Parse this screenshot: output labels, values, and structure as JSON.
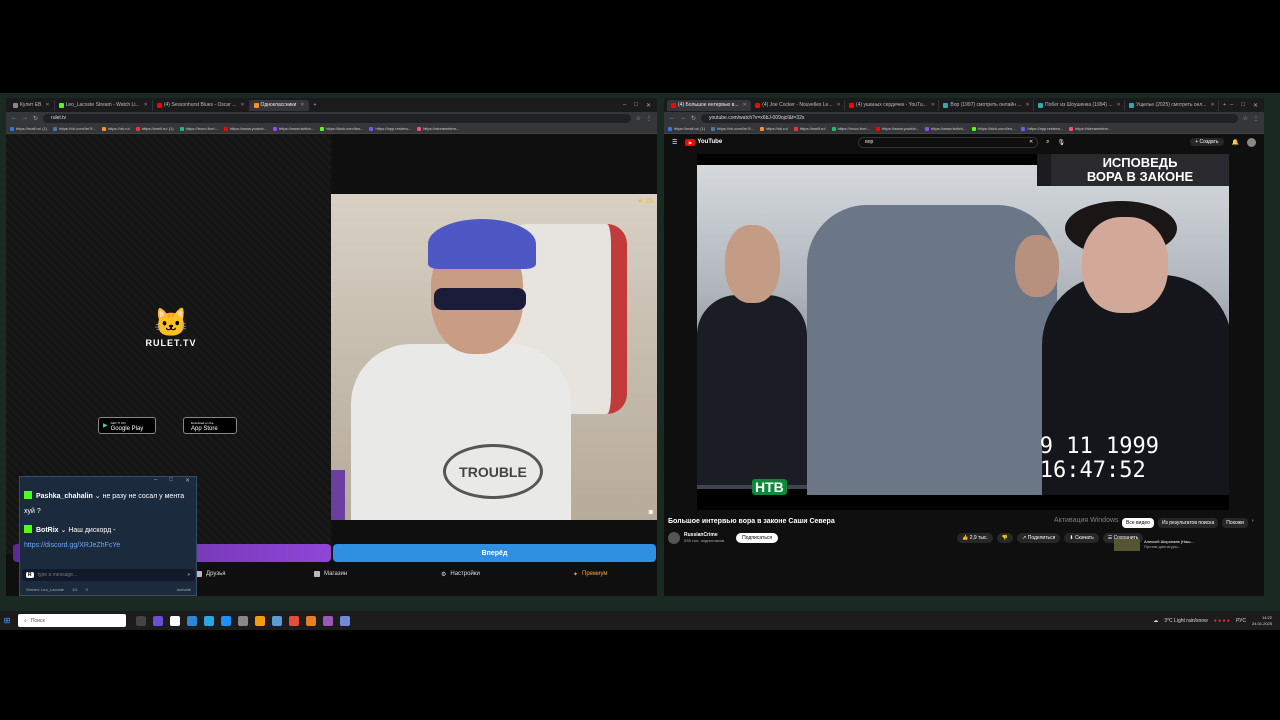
{
  "left_browser": {
    "tabs": [
      {
        "label": "Кулит ЕВ",
        "color": "#888",
        "active": false
      },
      {
        "label": "Leo_Lacoste Stream - Watch Li...",
        "color": "#53fc18",
        "active": false
      },
      {
        "label": "(4) Sessonhurst Blues - Oscar ...",
        "color": "#ff0000",
        "active": false
      },
      {
        "label": "Одноклассники",
        "color": "#f7931e",
        "active": true
      }
    ],
    "url": "rulet.tv",
    "bookmarks": [
      "https://mail.ru/ (1)",
      "https://vk.com/im?f...",
      "https://ok.ru/",
      "https://smili.ru/ (1)",
      "https://trovo.live/...",
      "https://www.youtub...",
      "https://www.twitch...",
      "https://kick.com/leo...",
      "https://app.restrea...",
      "https://streamelem..."
    ],
    "site": {
      "brand": "RULET.TV",
      "google_play_small": "GET IT ON",
      "google_play": "Google Play",
      "app_store_small": "Download on the",
      "app_store": "App Store",
      "cam_count": "25",
      "start_button": "Вперёд",
      "nav": {
        "friends": "Друзья",
        "shop": "Магазин",
        "settings": "Настройки",
        "premium": "Премиум"
      }
    },
    "chat": {
      "messages": [
        {
          "user": "Pashka_chahalin",
          "text": "не разу не сосал у мента хуй ?"
        },
        {
          "user": "BotRix",
          "text": "Наш дискорд -"
        }
      ],
      "link": "https://discord.gg/XRJeZhFcYe",
      "input_placeholder": "type a message...",
      "footer_channel": "Stream: Leo_Lacoste",
      "footer_count": "1/1",
      "footer_viewers": "0",
      "footer_status": "Activate"
    }
  },
  "right_browser": {
    "tabs": [
      {
        "label": "(4) Большое интервью в...",
        "color": "#ff0000",
        "active": true
      },
      {
        "label": "(4) Joe Cocker - Nouvelles Le...",
        "color": "#ff0000",
        "active": false
      },
      {
        "label": "(4) ушаных сердечек - YouTu...",
        "color": "#ff0000",
        "active": false
      },
      {
        "label": "Вор (1997) смотреть онлайн ...",
        "color": "#3aa",
        "active": false
      },
      {
        "label": "Побег из Шоушенка (1994) ...",
        "color": "#3aa",
        "active": false
      },
      {
        "label": "Ущелье (2025) смотреть онл...",
        "color": "#3aa",
        "active": false
      }
    ],
    "url": "youtube.com/watch?v=x6bJ-009ojcI&t=32s",
    "bookmarks": [
      "https://mail.ru/ (1)",
      "https://vk.com/im?f...",
      "https://ok.ru/",
      "https://smili.ru/",
      "https://trovo.live/...",
      "https://www.youtub...",
      "https://www.twitch...",
      "https://kick.com/leo...",
      "https://app.restrea...",
      "https://streamelem..."
    ],
    "youtube": {
      "logo": "YouTube",
      "search_value": "вор",
      "create": "Создать",
      "banner_line1": "ИСПОВЕДЬ",
      "banner_line2": "ВОРА В ЗАКОНЕ",
      "timestamp_line1": "9 11 1999",
      "timestamp_line2": "16:47:52",
      "channel_logo": "НТВ",
      "title": "Большое интервью вора в законе Саши Севера",
      "channel": "RussianCrime",
      "subscribers": "535 тыс. подписчиков",
      "subscribe": "Подписаться",
      "likes": "2,9 тыс.",
      "share": "Поделиться",
      "download": "Скачать",
      "save": "Сохранить",
      "chips": [
        "Все видео",
        "Из результатов поиска",
        "Похожи"
      ],
      "activation": "Активация Windows",
      "rec_title": "Алексей Широпаев (Наш...",
      "rec_sub": "Против диктатуры..."
    }
  },
  "taskbar": {
    "search_placeholder": "Поиск",
    "weather": "3°C  Light rain/snow",
    "lang": "РУС",
    "time": "14:22",
    "date": "24.01.2025"
  }
}
